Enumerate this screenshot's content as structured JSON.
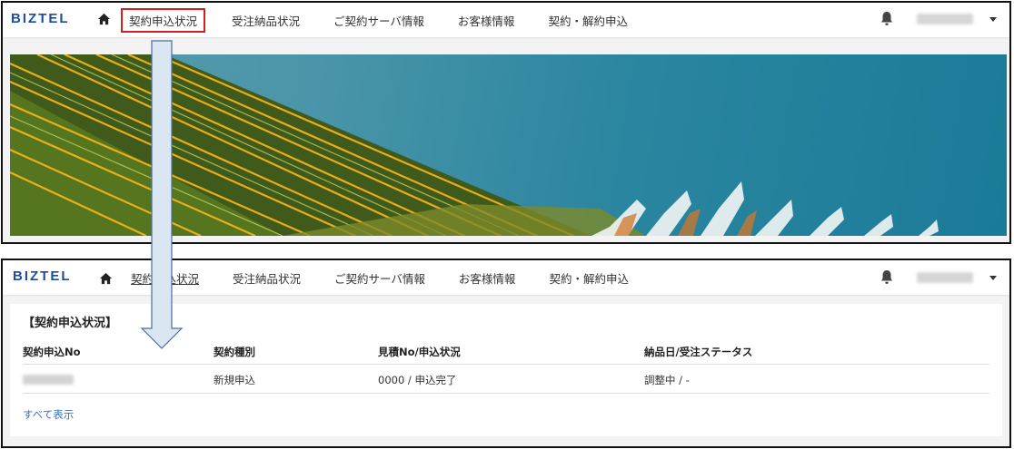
{
  "top_screen": {
    "logo": "BIZTEL",
    "nav": [
      {
        "label": "契約申込状況"
      },
      {
        "label": "受注納品状況"
      },
      {
        "label": "ご契約サーバ情報"
      },
      {
        "label": "お客様情報"
      },
      {
        "label": "契約・解約申込"
      }
    ],
    "user_menu": {
      "name_blurred": true
    }
  },
  "bottom_screen": {
    "logo": "BIZTEL",
    "nav": [
      {
        "label": "契約申込状況"
      },
      {
        "label": "受注納品状況"
      },
      {
        "label": "ご契約サーバ情報"
      },
      {
        "label": "お客様情報"
      },
      {
        "label": "契約・解約申込"
      }
    ],
    "section_title": "【契約申込状況】",
    "table": {
      "headers": [
        "契約申込No",
        "契約種別",
        "見積No/申込状況",
        "納品日/受注ステータス"
      ],
      "rows": [
        {
          "contract_no_blurred": true,
          "type": "新規申込",
          "quote_status": "0000 / 申込完了",
          "delivery_status": "調整中 / -"
        }
      ]
    },
    "show_all": "すべて表示"
  },
  "colors": {
    "brand": "#1f4c9c",
    "highlight_border": "#d21f1f",
    "link": "#3b6fc9",
    "arrow_fill": "#dbe6f3",
    "arrow_stroke": "#4a6fa0"
  },
  "icons": [
    "home-icon",
    "bell-icon",
    "caret-down-icon",
    "down-arrow-callout"
  ]
}
